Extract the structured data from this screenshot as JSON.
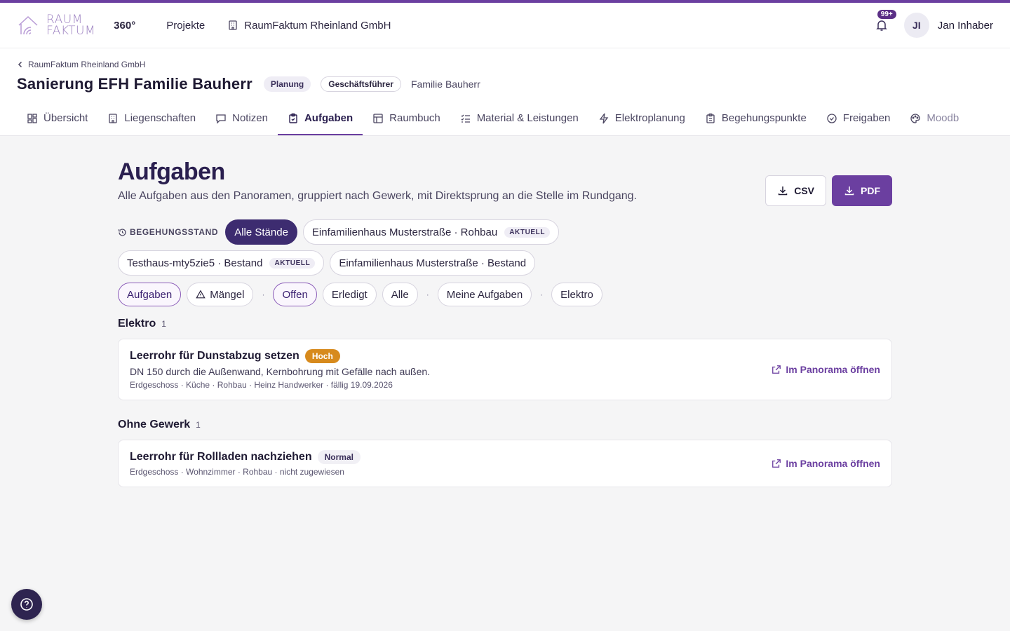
{
  "header": {
    "brand_line1": "RAUM",
    "brand_line2": "FAKTUM",
    "brand_suffix": "360°",
    "nav_projects": "Projekte",
    "nav_company": "RaumFaktum Rheinland GmbH",
    "notification_count": "99+",
    "user_initials": "JI",
    "user_name": "Jan Inhaber",
    "accent_color": "#6b3fa0"
  },
  "project": {
    "breadcrumb": "RaumFaktum Rheinland GmbH",
    "title": "Sanierung EFH Familie Bauherr",
    "status": "Planung",
    "role": "Geschäftsführer",
    "client": "Familie Bauherr"
  },
  "tabs": [
    {
      "label": "Übersicht",
      "icon": "grid-icon"
    },
    {
      "label": "Liegenschaften",
      "icon": "building-icon"
    },
    {
      "label": "Notizen",
      "icon": "note-icon"
    },
    {
      "label": "Aufgaben",
      "icon": "clipboard-check-icon",
      "active": true
    },
    {
      "label": "Raumbuch",
      "icon": "table-icon"
    },
    {
      "label": "Material & Leistungen",
      "icon": "list-check-icon"
    },
    {
      "label": "Elektroplanung",
      "icon": "bolt-icon"
    },
    {
      "label": "Begehungspunkte",
      "icon": "clipboard-list-icon"
    },
    {
      "label": "Freigaben",
      "icon": "check-circle-icon"
    },
    {
      "label": "Moodb",
      "icon": "palette-icon"
    }
  ],
  "page": {
    "title": "Aufgaben",
    "description": "Alle Aufgaben aus den Panoramen, gruppiert nach Gewerk, mit Direktsprung an die Stelle im Rundgang.",
    "csv_label": "CSV",
    "pdf_label": "PDF"
  },
  "stand_filter": {
    "label": "BEGEHUNGSSTAND",
    "options": [
      {
        "label": "Alle Stände",
        "selected": true,
        "tag": ""
      },
      {
        "label": "Einfamilienhaus Musterstraße · Rohbau",
        "tag": "AKTUELL"
      },
      {
        "label": "Testhaus-mty5zie5 · Bestand",
        "tag": "AKTUELL"
      },
      {
        "label": "Einfamilienhaus Musterstraße · Bestand",
        "tag": ""
      }
    ]
  },
  "filters": {
    "aufgaben": "Aufgaben",
    "maengel": "Mängel",
    "offen": "Offen",
    "erledigt": "Erledigt",
    "alle": "Alle",
    "meine": "Meine Aufgaben",
    "elektro": "Elektro",
    "separator": "·"
  },
  "groups": [
    {
      "name": "Elektro",
      "count": "1",
      "tasks": [
        {
          "title": "Leerrohr für Dunstabzug setzen",
          "priority": "Hoch",
          "description": "DN 150 durch die Außenwand, Kernbohrung mit Gefälle nach außen.",
          "meta": "Erdgeschoss · Küche · Rohbau · Heinz Handwerker · fällig 19.09.2026",
          "link": "Im Panorama öffnen"
        }
      ]
    },
    {
      "name": "Ohne Gewerk",
      "count": "1",
      "tasks": [
        {
          "title": "Leerrohr für Rollladen nachziehen",
          "priority": "Normal",
          "description": "",
          "meta": "Erdgeschoss · Wohnzimmer · Rohbau · nicht zugewiesen",
          "link": "Im Panorama öffnen"
        }
      ]
    }
  ]
}
